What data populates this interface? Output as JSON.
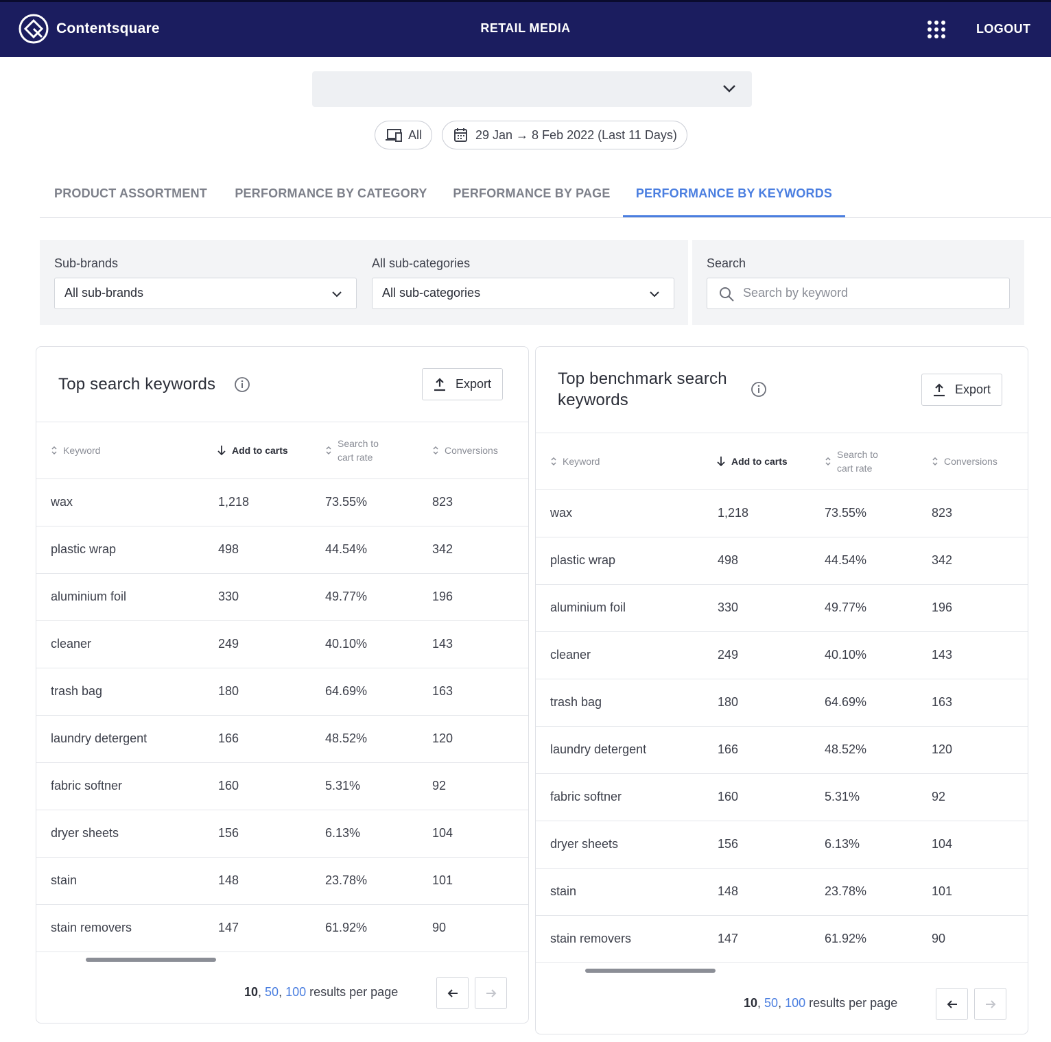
{
  "header": {
    "logo_text": "Contentsquare",
    "app_title": "RETAIL MEDIA",
    "logout_label": "LOGOUT"
  },
  "site_selector": {
    "value": ""
  },
  "device_filter": {
    "label": "All"
  },
  "date_filter": {
    "label": "29 Jan → 8 Feb 2022 (Last 11 Days)"
  },
  "tabs": [
    {
      "label": "PRODUCT ASSORTMENT",
      "active": false
    },
    {
      "label": "PERFORMANCE BY CATEGORY",
      "active": false
    },
    {
      "label": "PERFORMANCE BY PAGE",
      "active": false
    },
    {
      "label": "PERFORMANCE BY KEYWORDS",
      "active": true
    }
  ],
  "filters": {
    "subbrands": {
      "label": "Sub-brands",
      "value": "All sub-brands"
    },
    "subcategories": {
      "label": "All sub-categories",
      "value": "All sub-categories"
    },
    "search": {
      "label": "Search",
      "placeholder": "Search by keyword"
    }
  },
  "columns": {
    "keyword": "Keyword",
    "add_to_carts": "Add to carts",
    "search_to_cart_rate_1": "Search to",
    "search_to_cart_rate_2": "cart rate",
    "conversions": "Conversions"
  },
  "left_card": {
    "title": "Top search keywords",
    "export_label": "Export",
    "rows": [
      {
        "keyword": "wax",
        "add_to_carts": "1,218",
        "rate": "73.55%",
        "conversions": "823"
      },
      {
        "keyword": "plastic wrap",
        "add_to_carts": "498",
        "rate": "44.54%",
        "conversions": "342"
      },
      {
        "keyword": "aluminium foil",
        "add_to_carts": "330",
        "rate": "49.77%",
        "conversions": "196"
      },
      {
        "keyword": "cleaner",
        "add_to_carts": "249",
        "rate": "40.10%",
        "conversions": "143"
      },
      {
        "keyword": "trash bag",
        "add_to_carts": "180",
        "rate": "64.69%",
        "conversions": "163"
      },
      {
        "keyword": "laundry detergent",
        "add_to_carts": "166",
        "rate": "48.52%",
        "conversions": "120"
      },
      {
        "keyword": "fabric softner",
        "add_to_carts": "160",
        "rate": "5.31%",
        "conversions": "92"
      },
      {
        "keyword": "dryer sheets",
        "add_to_carts": "156",
        "rate": "6.13%",
        "conversions": "104"
      },
      {
        "keyword": "stain",
        "add_to_carts": "148",
        "rate": "23.78%",
        "conversions": "101"
      },
      {
        "keyword": "stain removers",
        "add_to_carts": "147",
        "rate": "61.92%",
        "conversions": "90"
      }
    ]
  },
  "right_card": {
    "title_line1": "Top benchmark search",
    "title_line2": "keywords",
    "export_label": "Export",
    "rows": [
      {
        "keyword": "wax",
        "add_to_carts": "1,218",
        "rate": "73.55%",
        "conversions": "823"
      },
      {
        "keyword": "plastic wrap",
        "add_to_carts": "498",
        "rate": "44.54%",
        "conversions": "342"
      },
      {
        "keyword": "aluminium foil",
        "add_to_carts": "330",
        "rate": "49.77%",
        "conversions": "196"
      },
      {
        "keyword": "cleaner",
        "add_to_carts": "249",
        "rate": "40.10%",
        "conversions": "143"
      },
      {
        "keyword": "trash bag",
        "add_to_carts": "180",
        "rate": "64.69%",
        "conversions": "163"
      },
      {
        "keyword": "laundry detergent",
        "add_to_carts": "166",
        "rate": "48.52%",
        "conversions": "120"
      },
      {
        "keyword": "fabric softner",
        "add_to_carts": "160",
        "rate": "5.31%",
        "conversions": "92"
      },
      {
        "keyword": "dryer sheets",
        "add_to_carts": "156",
        "rate": "6.13%",
        "conversions": "104"
      },
      {
        "keyword": "stain",
        "add_to_carts": "148",
        "rate": "23.78%",
        "conversions": "101"
      },
      {
        "keyword": "stain removers",
        "add_to_carts": "147",
        "rate": "61.92%",
        "conversions": "90"
      }
    ]
  },
  "pagination": {
    "option_current": "10",
    "sep1": ", ",
    "option_50": "50",
    "sep2": ", ",
    "option_100": "100",
    "suffix": " results per page"
  },
  "colors": {
    "header_bg": "#1b1d5f",
    "accent": "#4a7ee0"
  }
}
